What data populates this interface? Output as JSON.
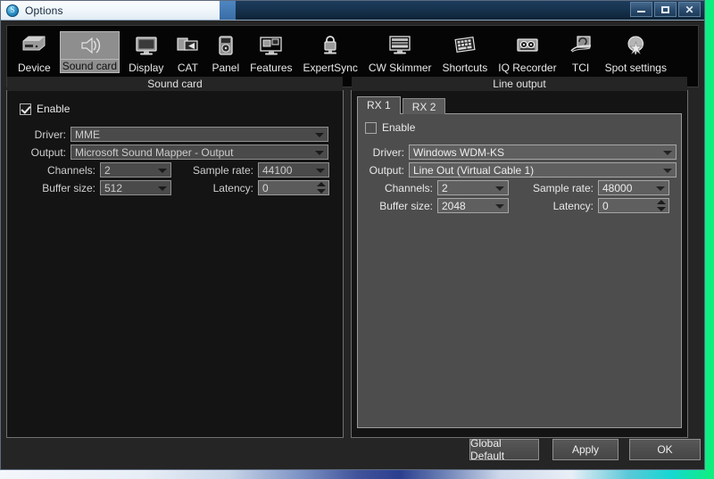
{
  "window": {
    "title": "Options",
    "app_icon": "app-logo-icon",
    "controls": {
      "minimize": "minimize-icon",
      "maximize": "maximize-icon",
      "close": "close-icon"
    }
  },
  "toolbar": {
    "selected": "Sound card",
    "items": [
      {
        "label": "Device",
        "icon": "hard-drive-icon"
      },
      {
        "label": "Sound card",
        "icon": "speaker-icon"
      },
      {
        "label": "Display",
        "icon": "monitor-icon"
      },
      {
        "label": "CAT",
        "icon": "cat-connector-icon"
      },
      {
        "label": "Panel",
        "icon": "panel-device-icon"
      },
      {
        "label": "Features",
        "icon": "features-windows-icon"
      },
      {
        "label": "ExpertSync",
        "icon": "lock-icon"
      },
      {
        "label": "CW Skimmer",
        "icon": "cw-skimmer-icon"
      },
      {
        "label": "Shortcuts",
        "icon": "keyboard-shortcuts-icon"
      },
      {
        "label": "IQ Recorder",
        "icon": "tape-recorder-icon"
      },
      {
        "label": "TCI",
        "icon": "tci-icon"
      },
      {
        "label": "Spot settings",
        "icon": "map-pin-star-icon"
      }
    ]
  },
  "sound_card": {
    "title": "Sound card",
    "enable": {
      "label": "Enable",
      "checked": true
    },
    "driver": {
      "label": "Driver:",
      "value": "MME"
    },
    "output": {
      "label": "Output:",
      "value": "Microsoft Sound Mapper - Output"
    },
    "channels": {
      "label": "Channels:",
      "value": "2"
    },
    "sample_rate": {
      "label": "Sample rate:",
      "value": "44100"
    },
    "buffer_size": {
      "label": "Buffer size:",
      "value": "512"
    },
    "latency": {
      "label": "Latency:",
      "value": "0"
    }
  },
  "line_output": {
    "title": "Line output",
    "tabs": [
      {
        "label": "RX 1",
        "active": true
      },
      {
        "label": "RX 2",
        "active": false
      }
    ],
    "enable": {
      "label": "Enable",
      "checked": false
    },
    "driver": {
      "label": "Driver:",
      "value": "Windows WDM-KS"
    },
    "output": {
      "label": "Output:",
      "value": "Line Out (Virtual Cable 1)"
    },
    "channels": {
      "label": "Channels:",
      "value": "2"
    },
    "sample_rate": {
      "label": "Sample rate:",
      "value": "48000"
    },
    "buffer_size": {
      "label": "Buffer size:",
      "value": "2048"
    },
    "latency": {
      "label": "Latency:",
      "value": "0"
    }
  },
  "footer": {
    "global_default": "Global Default",
    "apply": "Apply",
    "ok": "OK"
  },
  "colors": {
    "window_bg": "#252525",
    "panel_dark": "#141414",
    "tab_panel": "#4d4d4d",
    "toolbar_bg": "#050505",
    "accent_select": "#8e8e8e"
  }
}
